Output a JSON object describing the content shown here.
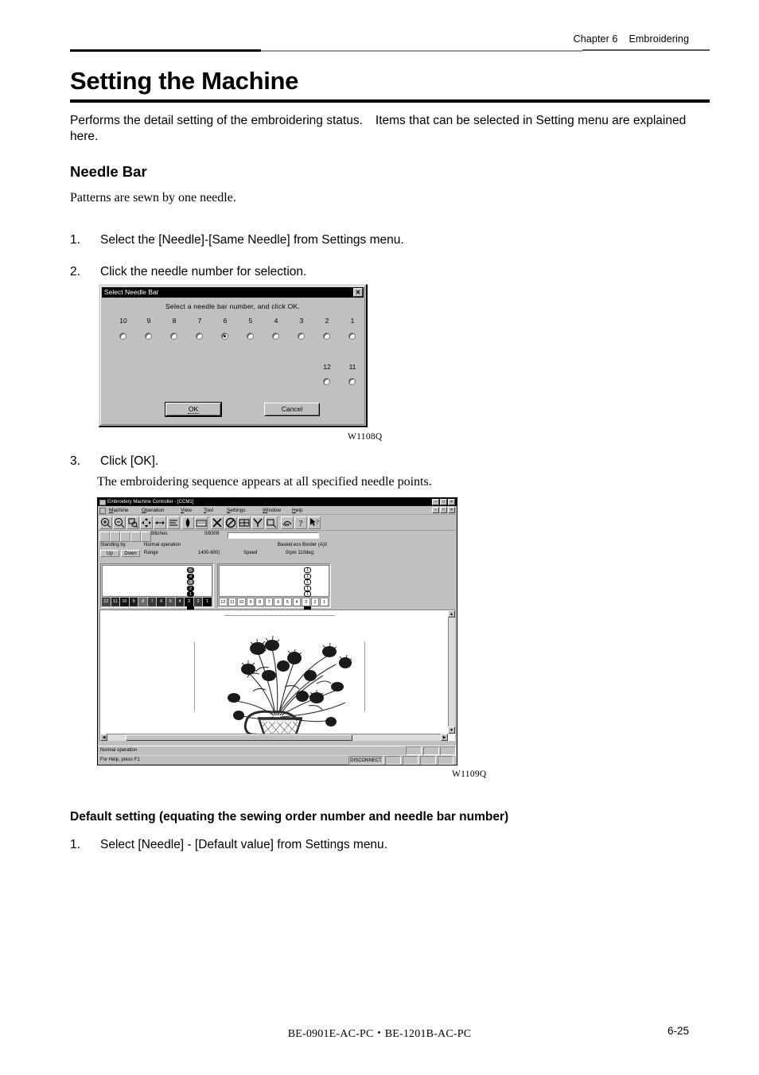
{
  "header": {
    "chapter": "Chapter 6",
    "section": "Embroidering"
  },
  "title": "Setting the Machine",
  "intro": {
    "part1": "Performs the detail setting of the embroidering status.",
    "part2": "Items that can be selected in Setting menu are explained here."
  },
  "subheading": "Needle Bar",
  "lead": "Patterns are sewn by one needle.",
  "steps": [
    {
      "num": "1.",
      "text": "Select the [Needle]-[Same Needle] from Settings menu."
    },
    {
      "num": "2.",
      "text": "Click the needle number for selection."
    },
    {
      "num": "3.",
      "text": "Click [OK]."
    }
  ],
  "step3_note": "The embroidering sequence appears at all specified needle points.",
  "figures": {
    "fig1_caption": "W1108Q",
    "fig2_caption": "W1109Q"
  },
  "default_section": {
    "heading": "Default setting (equating the sewing order number and needle bar number)",
    "step_num": "1.",
    "step_text": "Select [Needle] - [Default value] from Settings menu."
  },
  "footer": {
    "models": "BE-0901E-AC-PC・BE-1201B-AC-PC",
    "page": "6-25"
  },
  "dialog": {
    "title": "Select Needle Bar",
    "close_label": "✕",
    "prompt": "Select a needle bar number, and click OK.",
    "row1_numbers": [
      "10",
      "9",
      "8",
      "7",
      "6",
      "5",
      "4",
      "3",
      "2",
      "1"
    ],
    "row2_numbers": [
      "12",
      "11"
    ],
    "selected_needle": "6",
    "ok_label": "OK",
    "cancel_label": "Cancel"
  },
  "app": {
    "title": "Embroidery Machine Controller - [CCM1]",
    "window_buttons": [
      "–",
      "□",
      "✕"
    ],
    "mdi_buttons": [
      "–",
      "□",
      "✕"
    ],
    "menu": [
      "Machine",
      "Operation",
      "View",
      "Tool",
      "Settings",
      "Window",
      "Help"
    ],
    "toolbar_icons": [
      "zoom-in-icon",
      "zoom-out-icon",
      "zoom-region-icon",
      "move-all-icon",
      "move-icon",
      "align-icon",
      "bobbin-icon",
      "frame-icon",
      "cancel-x-icon",
      "prohibit-icon",
      "grid-icon",
      "trace-icon",
      "needle-set-icon",
      "thread-icon",
      "help-icon",
      "help-pointer-icon"
    ],
    "toolbar2_icons": [
      "origin-icon",
      "needle-icon",
      "copy-icon",
      "updown-icon",
      "stop-icon"
    ],
    "stitches_label": "Stitches",
    "stitches_count": "0/8309",
    "status": {
      "state": "Standing by",
      "operation": "Normal operation",
      "design": "Basket.ecs Border (A)0",
      "up_label": "Up",
      "down_label": "Down",
      "range_label": "Range",
      "range_value": "1400-800)",
      "speed_label": "Speed",
      "speed_value": "0rpm 110deg."
    },
    "needle_scale": [
      "12",
      "11",
      "10",
      "9",
      "8",
      "7",
      "6",
      "5",
      "4",
      "3",
      "2",
      "1"
    ],
    "left_panel_sequence": [
      "5",
      "4",
      "3",
      "2",
      "1"
    ],
    "right_panel_sequence": [
      "1",
      "1",
      "1",
      "1",
      "1"
    ],
    "selected_column": "3",
    "statusbar_operation": "Normal operation",
    "statusbar_help": "For Help, press F1",
    "statusbar_connection": "DISCONNECT"
  }
}
